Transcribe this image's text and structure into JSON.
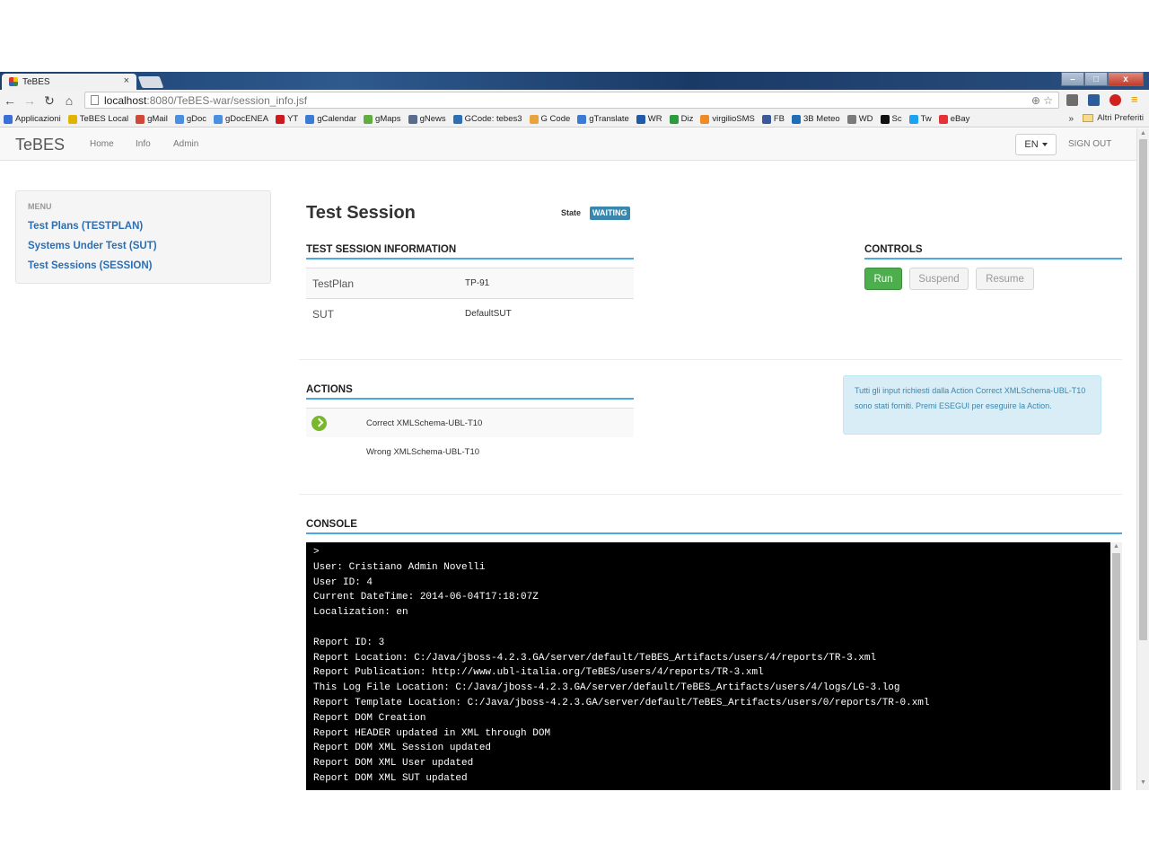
{
  "browser": {
    "tab_title": "TeBES",
    "tab_close": "×",
    "url_host": "localhost",
    "url_path": ":8080/TeBES-war/session_info.jsf",
    "window_controls": [
      "–",
      "□",
      "x"
    ],
    "bookmarks": [
      {
        "label": "Applicazioni",
        "color": "#3a6ed8"
      },
      {
        "label": "TeBES Local",
        "color": "#e0b400"
      },
      {
        "label": "gMail",
        "color": "#d14836"
      },
      {
        "label": "gDoc",
        "color": "#4a90e2"
      },
      {
        "label": "gDocENEA",
        "color": "#4a90e2"
      },
      {
        "label": "YT",
        "color": "#cc181e"
      },
      {
        "label": "gCalendar",
        "color": "#3a7bd5"
      },
      {
        "label": "gMaps",
        "color": "#5fae3f"
      },
      {
        "label": "gNews",
        "color": "#5a6b8c"
      },
      {
        "label": "GCode: tebes3",
        "color": "#2f6fb3"
      },
      {
        "label": "G Code",
        "color": "#e8a33d"
      },
      {
        "label": "gTranslate",
        "color": "#3a7bd5"
      },
      {
        "label": "WR",
        "color": "#1e5aa8"
      },
      {
        "label": "Diz",
        "color": "#2e9a3e"
      },
      {
        "label": "virgilioSMS",
        "color": "#f08a24"
      },
      {
        "label": "FB",
        "color": "#3b5998"
      },
      {
        "label": "3B Meteo",
        "color": "#1e6fb8"
      },
      {
        "label": "WD",
        "color": "#7a7a7a"
      },
      {
        "label": "Sc",
        "color": "#111111"
      },
      {
        "label": "Tw",
        "color": "#1da1f2"
      },
      {
        "label": "eBay",
        "color": "#e53238"
      }
    ],
    "bookmarks_more": "»",
    "other_bookmarks": "Altri Preferiti"
  },
  "navbar": {
    "brand": "TeBES",
    "links": [
      "Home",
      "Info",
      "Admin"
    ],
    "language": "EN",
    "sign_out": "SIGN OUT"
  },
  "sidebar": {
    "header": "MENU",
    "items": [
      {
        "label": "Test Plans (TESTPLAN)"
      },
      {
        "label": "Systems Under Test (SUT)"
      },
      {
        "label": "Test Sessions (SESSION)"
      }
    ]
  },
  "main": {
    "title": "Test Session",
    "state_label": "State",
    "state_value": "WAITING",
    "info_heading": "TEST SESSION INFORMATION",
    "info_rows": [
      {
        "key": "TestPlan",
        "value": "TP-91"
      },
      {
        "key": "SUT",
        "value": "DefaultSUT"
      }
    ],
    "controls_heading": "CONTROLS",
    "controls": {
      "run": "Run",
      "suspend": "Suspend",
      "resume": "Resume"
    },
    "actions_heading": "ACTIONS",
    "actions": [
      {
        "label": "Correct XMLSchema-UBL-T10",
        "current": true
      },
      {
        "label": "Wrong XMLSchema-UBL-T10",
        "current": false
      }
    ],
    "alert_text": "Tutti gli input richiesti dalla Action Correct XMLSchema-UBL-T10 sono stati forniti. Premi ESEGUI per eseguire la Action.",
    "console_heading": "CONSOLE",
    "console_lines": [
      ">",
      "User: Cristiano Admin Novelli",
      "User ID: 4",
      "Current DateTime: 2014-06-04T17:18:07Z",
      "Localization: en",
      "",
      "Report ID: 3",
      "Report Location: C:/Java/jboss-4.2.3.GA/server/default/TeBES_Artifacts/users/4/reports/TR-3.xml",
      "Report Publication: http://www.ubl-italia.org/TeBES/users/4/reports/TR-3.xml",
      "This Log File Location: C:/Java/jboss-4.2.3.GA/server/default/TeBES_Artifacts/users/4/logs/LG-3.log",
      "Report Template Location: C:/Java/jboss-4.2.3.GA/server/default/TeBES_Artifacts/users/0/reports/TR-0.xml",
      "Report DOM Creation",
      "Report HEADER updated in XML through DOM",
      "Report DOM XML Session updated",
      "Report DOM XML User updated",
      "Report DOM XML SUT updated"
    ]
  }
}
